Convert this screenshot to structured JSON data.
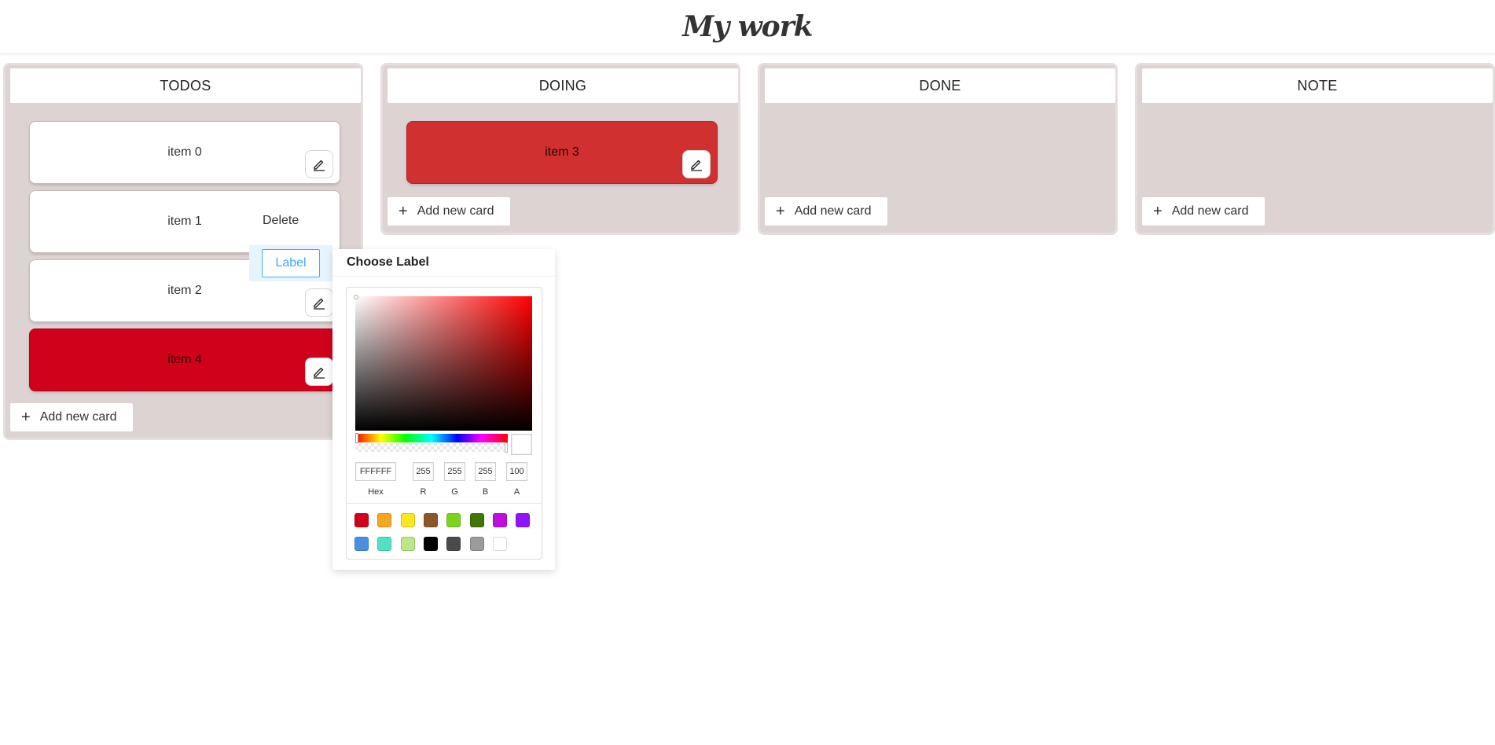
{
  "header": {
    "title": "My work"
  },
  "columns": [
    {
      "title": "TODOS",
      "add_label": "Add new card"
    },
    {
      "title": "DOING",
      "add_label": "Add new card"
    },
    {
      "title": "DONE",
      "add_label": "Add new card"
    },
    {
      "title": "NOTE",
      "add_label": "Add new card"
    }
  ],
  "cards": {
    "todos": [
      {
        "text": "item 0",
        "color": "#ffffff"
      },
      {
        "text": "item 1",
        "color": "#ffffff"
      },
      {
        "text": "item 2",
        "color": "#ffffff"
      },
      {
        "text": "item 4",
        "color": "#d0021b"
      }
    ],
    "doing": [
      {
        "text": "item 3",
        "color": "#d03030"
      }
    ]
  },
  "context_menu": {
    "delete_label": "Delete",
    "label_label": "Label"
  },
  "label_popover": {
    "title": "Choose Label",
    "hex_value": "FFFFFF",
    "r_value": "255",
    "g_value": "255",
    "b_value": "255",
    "a_value": "100",
    "hex_label": "Hex",
    "r_label": "R",
    "g_label": "G",
    "b_label": "B",
    "a_label": "A",
    "hue_color": "#ff0000",
    "preset_colors": [
      "#d0021b",
      "#f5a623",
      "#f8e71c",
      "#8b572a",
      "#7ed321",
      "#417505",
      "#bd10e0",
      "#9013fe",
      "#4a90e2",
      "#50e3c2",
      "#b8e986",
      "#000000",
      "#4a4a4a",
      "#9b9b9b",
      "#ffffff"
    ]
  },
  "icons": {
    "edit": "pencil-icon",
    "add": "plus-icon"
  }
}
